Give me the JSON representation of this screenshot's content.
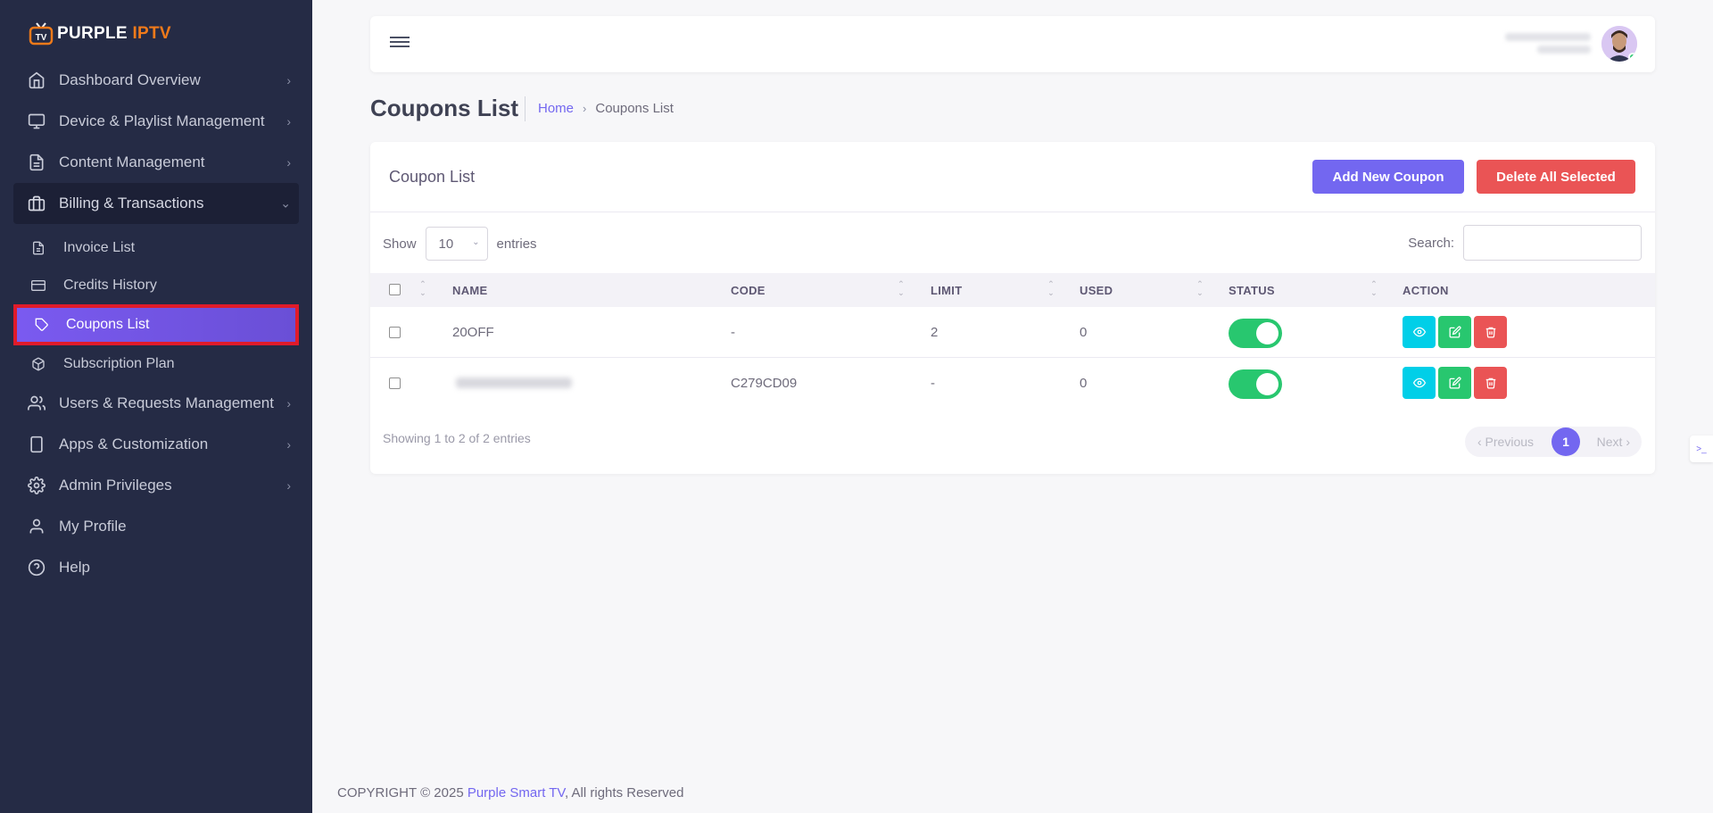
{
  "brand": {
    "name": "PURPLE",
    "accent": "IPTV",
    "tv_label": "TV"
  },
  "sidebar": {
    "items": [
      {
        "label": "Dashboard Overview",
        "icon": "home-icon",
        "chevron": "›"
      },
      {
        "label": "Device & Playlist Management",
        "icon": "monitor-icon",
        "chevron": "›"
      },
      {
        "label": "Content Management",
        "icon": "file-text-icon",
        "chevron": "›"
      },
      {
        "label": "Billing & Transactions",
        "icon": "briefcase-icon",
        "chevron": "⌄"
      }
    ],
    "sub_items": [
      {
        "label": "Invoice List",
        "icon": "file-icon"
      },
      {
        "label": "Credits History",
        "icon": "credit-card-icon"
      },
      {
        "label": "Coupons List",
        "icon": "tag-icon"
      },
      {
        "label": "Subscription Plan",
        "icon": "package-icon"
      }
    ],
    "items_after": [
      {
        "label": "Users & Requests Management",
        "icon": "users-icon",
        "chevron": "›"
      },
      {
        "label": "Apps & Customization",
        "icon": "tablet-icon",
        "chevron": "›"
      },
      {
        "label": "Admin Privileges",
        "icon": "settings-icon",
        "chevron": "›"
      },
      {
        "label": "My Profile",
        "icon": "user-icon"
      },
      {
        "label": "Help",
        "icon": "help-circle-icon"
      }
    ]
  },
  "page": {
    "title": "Coupons List",
    "breadcrumb": {
      "home": "Home",
      "separator": "›",
      "current": "Coupons List"
    }
  },
  "card": {
    "title": "Coupon List",
    "add_button": "Add New Coupon",
    "delete_button": "Delete All Selected",
    "show_label": "Show",
    "entries_value": "10",
    "entries_label": "entries",
    "search_label": "Search:"
  },
  "table": {
    "headers": {
      "name": "NAME",
      "code": "CODE",
      "limit": "LIMIT",
      "used": "USED",
      "status": "STATUS",
      "action": "ACTION"
    },
    "rows": [
      {
        "name": "20OFF",
        "code": "-",
        "limit": "2",
        "used": "0",
        "status": "on"
      },
      {
        "name": "",
        "code": "C279CD09",
        "limit": "-",
        "used": "0",
        "status": "on"
      }
    ]
  },
  "pagination": {
    "info": "Showing 1 to 2 of 2 entries",
    "previous": "‹ Previous",
    "page": "1",
    "next": "Next ›"
  },
  "footer": {
    "prefix": "COPYRIGHT © 2025 ",
    "brand": "Purple Smart TV",
    "suffix": ", All rights Reserved"
  },
  "colors": {
    "primary": "#7367f0",
    "danger": "#ea5455",
    "success": "#28c76f",
    "info": "#00cfe8",
    "sidebar": "#252b45",
    "highlight": "#e01b2a"
  }
}
